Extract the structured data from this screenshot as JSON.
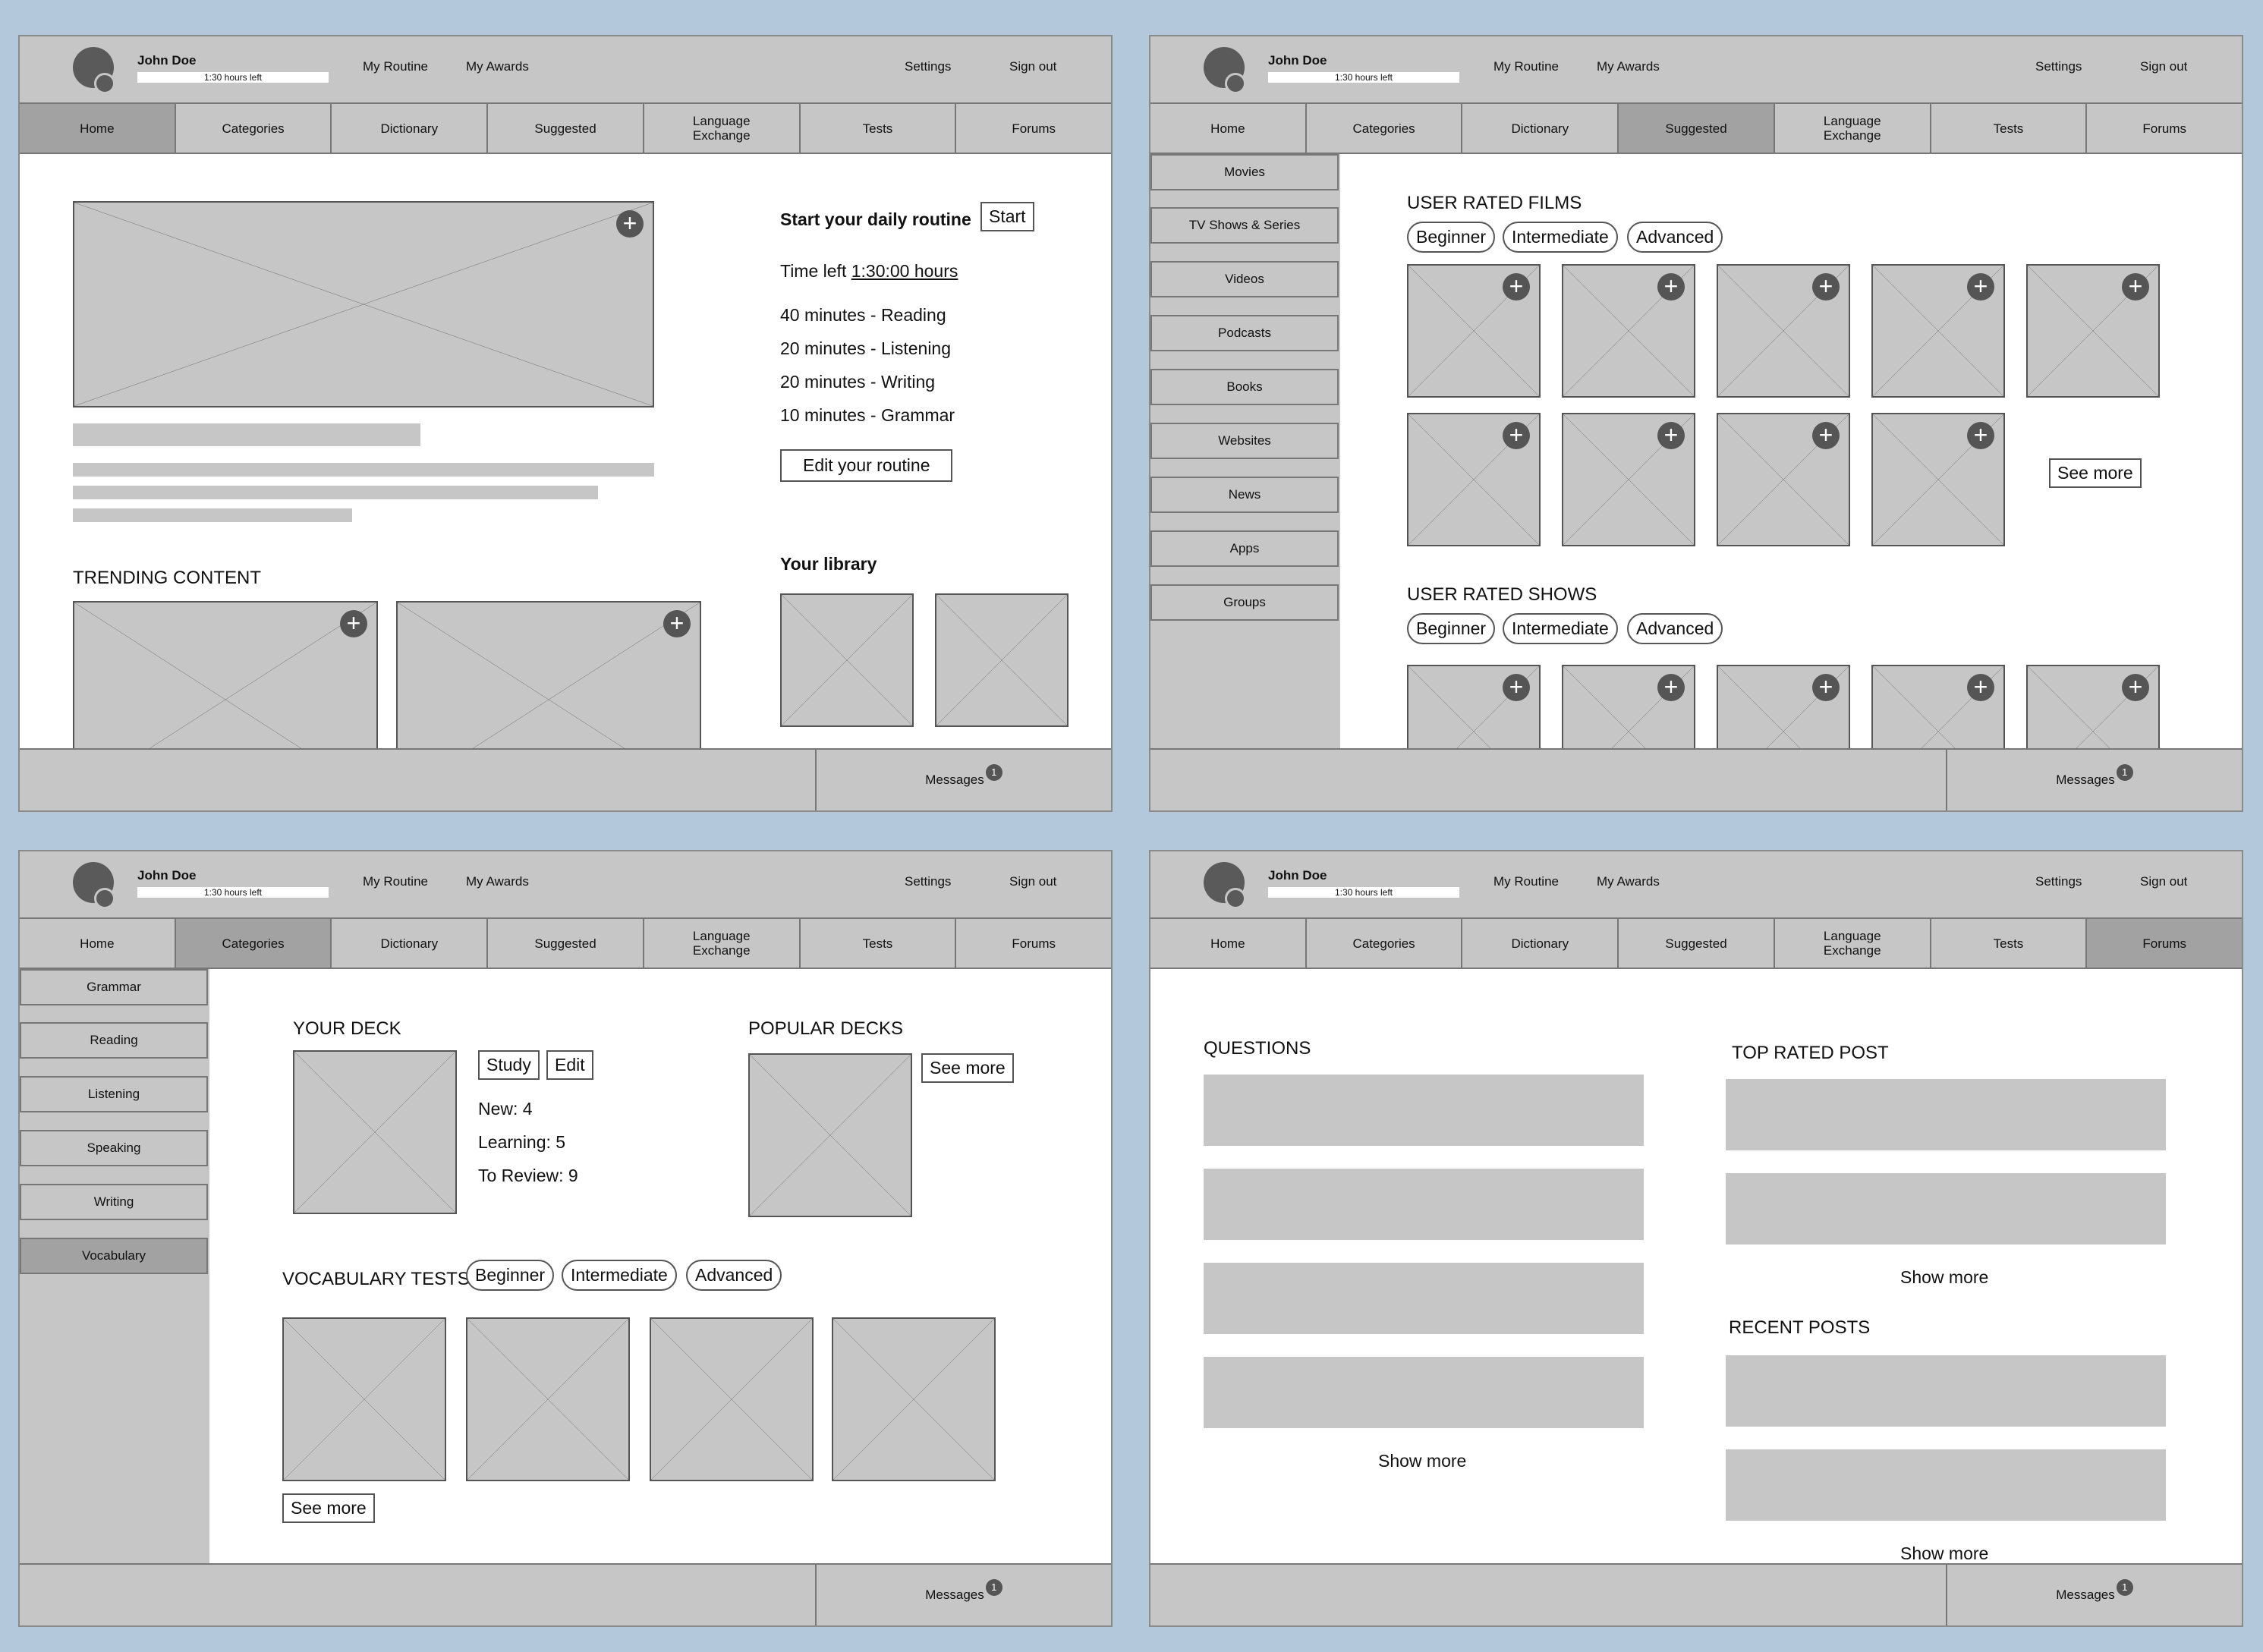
{
  "header": {
    "user_name": "John Doe",
    "time_left": "1:30 hours left",
    "my_routine": "My Routine",
    "my_awards": "My Awards",
    "settings": "Settings",
    "sign_out": "Sign out"
  },
  "nav": {
    "home": "Home",
    "categories": "Categories",
    "dictionary": "Dictionary",
    "suggested": "Suggested",
    "language_exchange": "Language Exchange",
    "tests": "Tests",
    "forums": "Forums"
  },
  "footer": {
    "messages": "Messages",
    "message_count": "1"
  },
  "home": {
    "routine_title": "Start your daily routine",
    "start_button": "Start",
    "time_left_label": "Time left",
    "time_left_value": "1:30:00 hours",
    "routine_items": [
      "40 minutes - Reading",
      "20 minutes - Listening",
      "20 minutes - Writing",
      "10 minutes - Grammar"
    ],
    "edit_routine": "Edit your routine",
    "trending_title": "TRENDING CONTENT",
    "library_title": "Your library"
  },
  "suggested": {
    "sidebar": [
      "Movies",
      "TV Shows & Series",
      "Videos",
      "Podcasts",
      "Books",
      "Websites",
      "News",
      "Apps",
      "Groups"
    ],
    "films_title": "USER RATED FILMS",
    "shows_title": "USER RATED SHOWS",
    "levels": [
      "Beginner",
      "Intermediate",
      "Advanced"
    ],
    "see_more": "See more"
  },
  "categories": {
    "sidebar": [
      "Grammar",
      "Reading",
      "Listening",
      "Speaking",
      "Writing",
      "Vocabulary"
    ],
    "deck_title": "YOUR DECK",
    "study": "Study",
    "edit": "Edit",
    "new_label": "New: 4",
    "learning_label": "Learning: 5",
    "review_label": "To Review: 9",
    "popular_title": "POPULAR DECKS",
    "see_more": "See more",
    "vocab_title": "VOCABULARY TESTS",
    "levels": [
      "Beginner",
      "Intermediate",
      "Advanced"
    ],
    "see_more_tests": "See more"
  },
  "forums": {
    "questions_title": "QUESTIONS",
    "top_rated_title": "TOP RATED POST",
    "recent_title": "RECENT POSTS",
    "show_more": "Show more"
  }
}
